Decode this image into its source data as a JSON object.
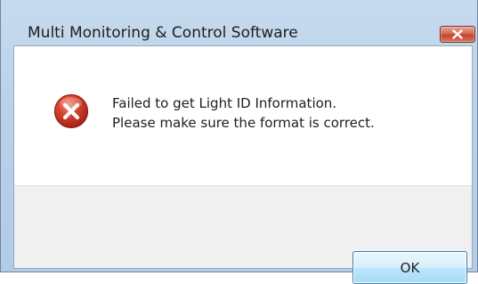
{
  "window": {
    "title": "Multi Monitoring & Control Software"
  },
  "titlebar": {
    "close_icon": "close-icon"
  },
  "dialog": {
    "icon": "error-icon",
    "message_lines": [
      "Failed to get Light ID Information.",
      "Please make sure the format is correct."
    ],
    "ok_label": "OK"
  },
  "colors": {
    "title_bar": "#b9d1ea",
    "close_button": "#c6442c",
    "error_icon": "#c0392b",
    "ok_button_border": "#3c7fb1",
    "footer": "#f0f0f0"
  }
}
